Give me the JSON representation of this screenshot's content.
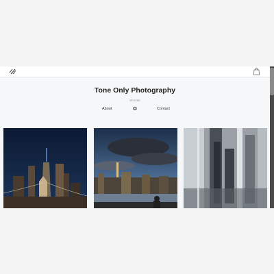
{
  "header": {
    "menu_icon": "hamburger-menu-icon",
    "cart_icon": "shopping-bag-icon"
  },
  "hero": {
    "title": "Tone Only Photography",
    "subtitle": "Shooter"
  },
  "nav": {
    "about_label": "About",
    "contact_label": "Contact",
    "middle_icon": "camera-icon"
  },
  "gallery": {
    "items": [
      {
        "subject": "Brooklyn Bridge and One World Trade Center at night"
      },
      {
        "subject": "Manhattan skyline at dusk under dramatic clouds"
      },
      {
        "subject": "Monochrome reflected skyline"
      }
    ]
  },
  "colors": {
    "page_background": "#f6f7f8",
    "header_background": "#ffffff",
    "title_color": "#222222",
    "scrollbar": "#4a4a4a"
  }
}
